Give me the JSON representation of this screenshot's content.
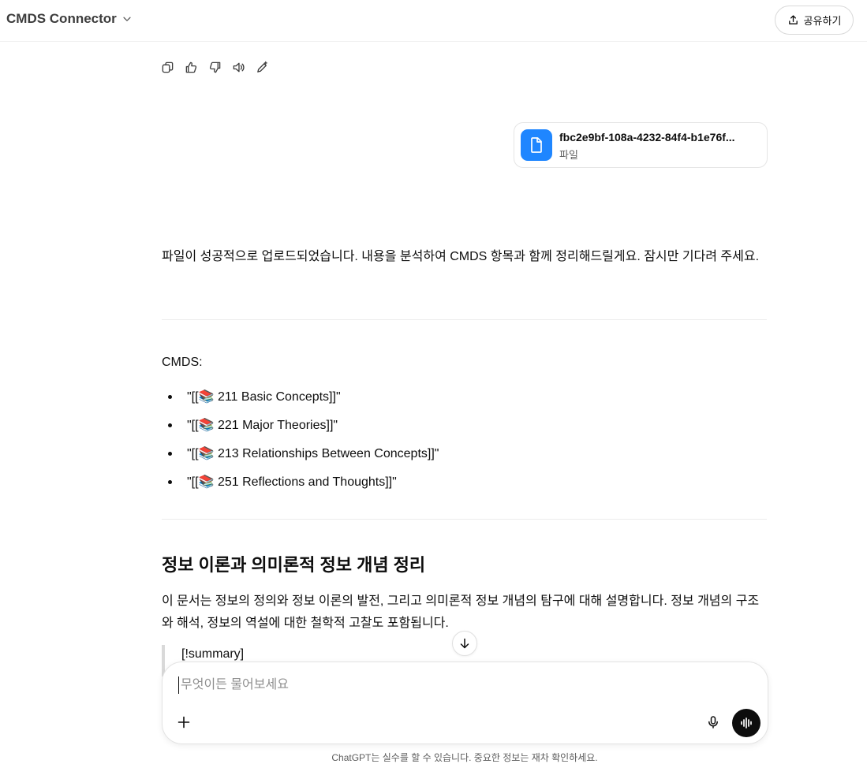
{
  "header": {
    "title": "CMDS Connector",
    "share_label": "공유하기"
  },
  "message_actions": [
    "copy-icon",
    "thumbs-up-icon",
    "thumbs-down-icon",
    "read-aloud-icon",
    "edit-icon"
  ],
  "file_card": {
    "name": "fbc2e9bf-108a-4232-84f4-b1e76f...",
    "type": "파일",
    "accent": "#1f86ff"
  },
  "assistant": {
    "upload_message": "파일이 성공적으로 업로드되었습니다. 내용을 분석하여 CMDS 항목과 함께 정리해드릴게요. 잠시만 기다려 주세요.",
    "cmds_label": "CMDS:",
    "cmds_items": [
      "\"[[📚 211 Basic Concepts]]\"",
      "\"[[📚 221 Major Theories]]\"",
      "\"[[📚 213 Relationships Between Concepts]]\"",
      "\"[[📚 251 Reflections and Thoughts]]\""
    ],
    "heading": "정보 이론과 의미론적 정보 개념 정리",
    "paragraph": "이 문서는 정보의 정의와 정보 이론의 발전, 그리고 의미론적 정보 개념의 탐구에 대해 설명합니다. 정보 개념의 구조와 해석, 정보의 역설에 대한 철학적 고찰도 포함됩니다.",
    "quote": "[!summary]"
  },
  "composer": {
    "placeholder": "무엇이든 물어보세요"
  },
  "disclaimer": "ChatGPT는 실수를 할 수 있습니다. 중요한 정보는 재차 확인하세요."
}
